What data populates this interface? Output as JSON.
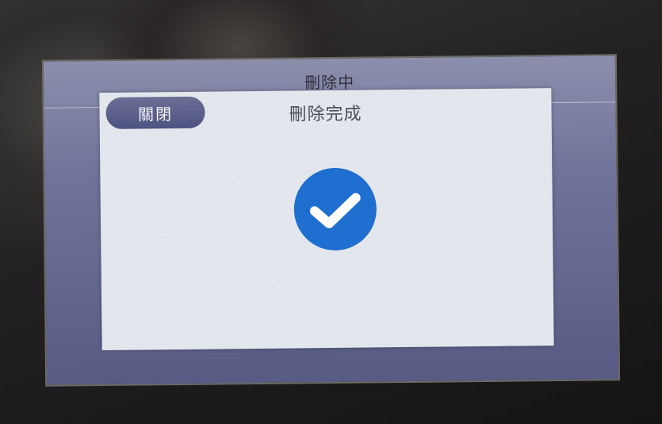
{
  "background_dialog": {
    "title": "刪除中"
  },
  "dialog": {
    "title": "刪除完成",
    "close_label": "關閉",
    "status_icon": "check-circle-icon"
  },
  "colors": {
    "accent": "#1f6fd0",
    "button": "#5b5f8a",
    "panel": "#e4e8ee"
  }
}
